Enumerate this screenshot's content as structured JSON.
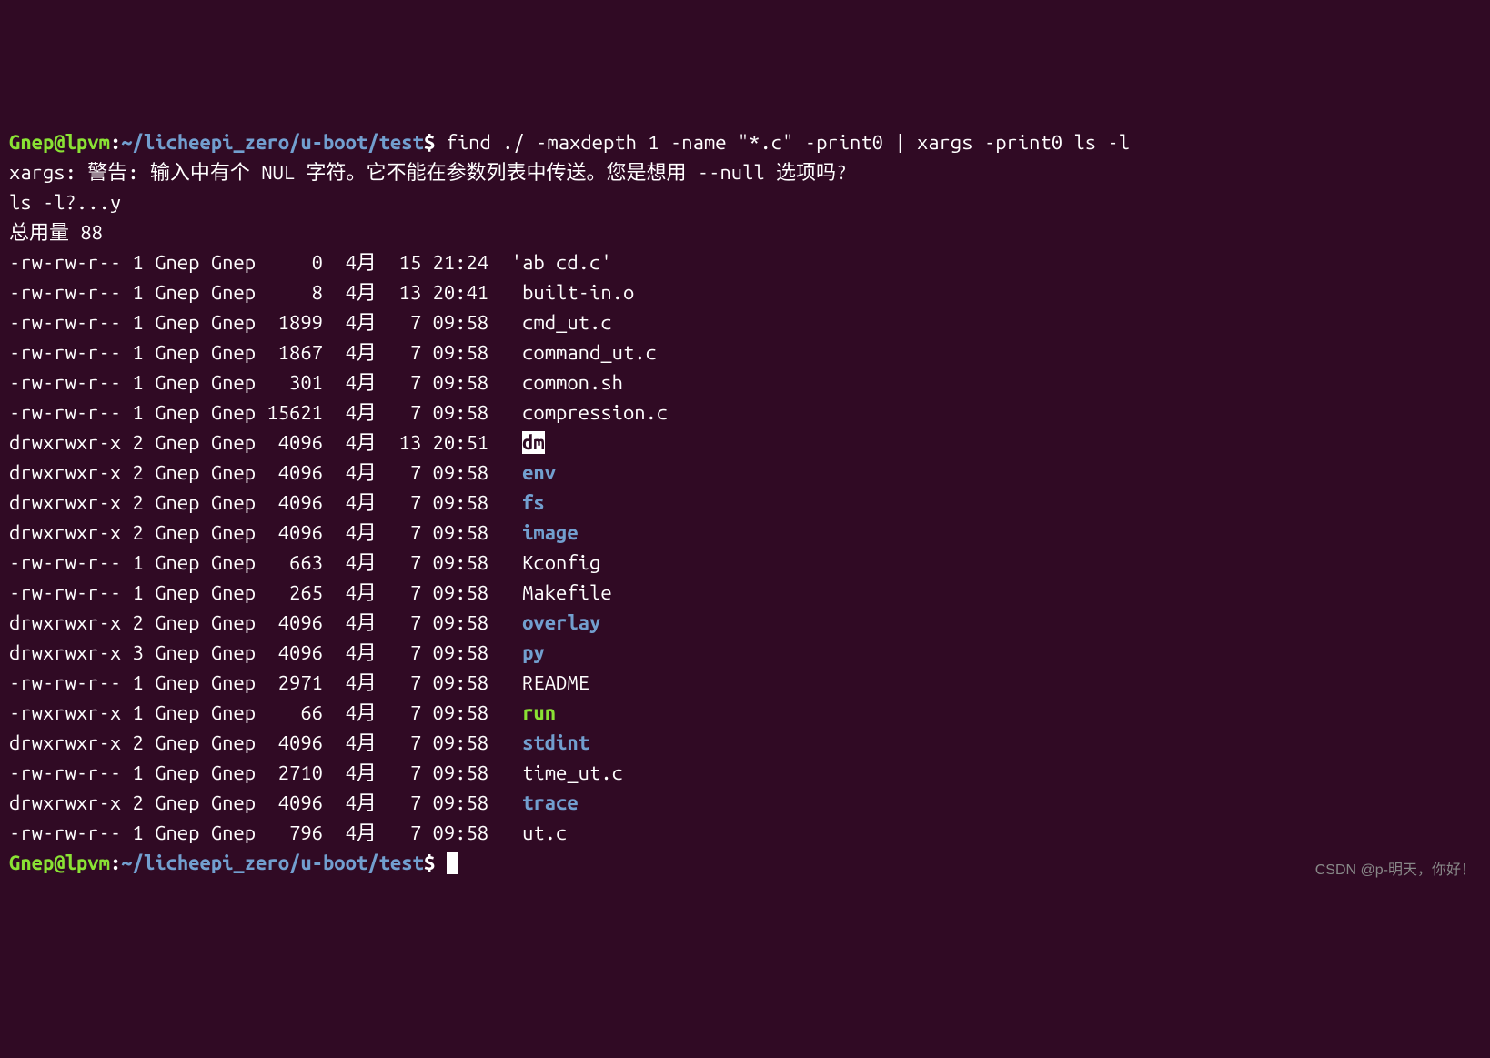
{
  "prompt": {
    "user": "Gnep",
    "at": "@",
    "host": "lpvm",
    "colon": ":",
    "path": "~/licheepi_zero/u-boot/test",
    "dollar": "$"
  },
  "command1": " find ./ -maxdepth 1 -name \"*.c\" -print0 | xargs -print0 ls -l",
  "warning": "xargs: 警告: 输入中有个 NUL 字符。它不能在参数列表中传送。您是想用 --null 选项吗?",
  "lsconfirm": "ls -l?...y",
  "totalline": "总用量 88",
  "rows": [
    {
      "perms": "-rw-rw-r--",
      "links": "1",
      "owner": "Gnep",
      "group": "Gnep",
      "size": "    0",
      "month": "4月",
      "day": "15",
      "time": "21:24",
      "name": "'ab cd.c'",
      "type": "file"
    },
    {
      "perms": "-rw-rw-r--",
      "links": "1",
      "owner": "Gnep",
      "group": "Gnep",
      "size": "    8",
      "month": "4月",
      "day": "13",
      "time": "20:41",
      "name": " built-in.o",
      "type": "file"
    },
    {
      "perms": "-rw-rw-r--",
      "links": "1",
      "owner": "Gnep",
      "group": "Gnep",
      "size": " 1899",
      "month": "4月",
      "day": " 7",
      "time": "09:58",
      "name": " cmd_ut.c",
      "type": "file"
    },
    {
      "perms": "-rw-rw-r--",
      "links": "1",
      "owner": "Gnep",
      "group": "Gnep",
      "size": " 1867",
      "month": "4月",
      "day": " 7",
      "time": "09:58",
      "name": " command_ut.c",
      "type": "file"
    },
    {
      "perms": "-rw-rw-r--",
      "links": "1",
      "owner": "Gnep",
      "group": "Gnep",
      "size": "  301",
      "month": "4月",
      "day": " 7",
      "time": "09:58",
      "name": " common.sh",
      "type": "file"
    },
    {
      "perms": "-rw-rw-r--",
      "links": "1",
      "owner": "Gnep",
      "group": "Gnep",
      "size": "15621",
      "month": "4月",
      "day": " 7",
      "time": "09:58",
      "name": " compression.c",
      "type": "file"
    },
    {
      "perms": "drwxrwxr-x",
      "links": "2",
      "owner": "Gnep",
      "group": "Gnep",
      "size": " 4096",
      "month": "4月",
      "day": "13",
      "time": "20:51",
      "name": "dm",
      "type": "highlighted",
      "prefix": " "
    },
    {
      "perms": "drwxrwxr-x",
      "links": "2",
      "owner": "Gnep",
      "group": "Gnep",
      "size": " 4096",
      "month": "4月",
      "day": " 7",
      "time": "09:58",
      "name": "env",
      "type": "dir",
      "prefix": " "
    },
    {
      "perms": "drwxrwxr-x",
      "links": "2",
      "owner": "Gnep",
      "group": "Gnep",
      "size": " 4096",
      "month": "4月",
      "day": " 7",
      "time": "09:58",
      "name": "fs",
      "type": "dir",
      "prefix": " "
    },
    {
      "perms": "drwxrwxr-x",
      "links": "2",
      "owner": "Gnep",
      "group": "Gnep",
      "size": " 4096",
      "month": "4月",
      "day": " 7",
      "time": "09:58",
      "name": "image",
      "type": "dir",
      "prefix": " "
    },
    {
      "perms": "-rw-rw-r--",
      "links": "1",
      "owner": "Gnep",
      "group": "Gnep",
      "size": "  663",
      "month": "4月",
      "day": " 7",
      "time": "09:58",
      "name": " Kconfig",
      "type": "file"
    },
    {
      "perms": "-rw-rw-r--",
      "links": "1",
      "owner": "Gnep",
      "group": "Gnep",
      "size": "  265",
      "month": "4月",
      "day": " 7",
      "time": "09:58",
      "name": " Makefile",
      "type": "file"
    },
    {
      "perms": "drwxrwxr-x",
      "links": "2",
      "owner": "Gnep",
      "group": "Gnep",
      "size": " 4096",
      "month": "4月",
      "day": " 7",
      "time": "09:58",
      "name": "overlay",
      "type": "dir",
      "prefix": " "
    },
    {
      "perms": "drwxrwxr-x",
      "links": "3",
      "owner": "Gnep",
      "group": "Gnep",
      "size": " 4096",
      "month": "4月",
      "day": " 7",
      "time": "09:58",
      "name": "py",
      "type": "dir",
      "prefix": " "
    },
    {
      "perms": "-rw-rw-r--",
      "links": "1",
      "owner": "Gnep",
      "group": "Gnep",
      "size": " 2971",
      "month": "4月",
      "day": " 7",
      "time": "09:58",
      "name": " README",
      "type": "file"
    },
    {
      "perms": "-rwxrwxr-x",
      "links": "1",
      "owner": "Gnep",
      "group": "Gnep",
      "size": "   66",
      "month": "4月",
      "day": " 7",
      "time": "09:58",
      "name": "run",
      "type": "exec",
      "prefix": " "
    },
    {
      "perms": "drwxrwxr-x",
      "links": "2",
      "owner": "Gnep",
      "group": "Gnep",
      "size": " 4096",
      "month": "4月",
      "day": " 7",
      "time": "09:58",
      "name": "stdint",
      "type": "dir",
      "prefix": " "
    },
    {
      "perms": "-rw-rw-r--",
      "links": "1",
      "owner": "Gnep",
      "group": "Gnep",
      "size": " 2710",
      "month": "4月",
      "day": " 7",
      "time": "09:58",
      "name": " time_ut.c",
      "type": "file"
    },
    {
      "perms": "drwxrwxr-x",
      "links": "2",
      "owner": "Gnep",
      "group": "Gnep",
      "size": " 4096",
      "month": "4月",
      "day": " 7",
      "time": "09:58",
      "name": "trace",
      "type": "dir",
      "prefix": " "
    },
    {
      "perms": "-rw-rw-r--",
      "links": "1",
      "owner": "Gnep",
      "group": "Gnep",
      "size": "  796",
      "month": "4月",
      "day": " 7",
      "time": "09:58",
      "name": " ut.c",
      "type": "file"
    }
  ],
  "watermark": "CSDN @p-明天，你好！"
}
